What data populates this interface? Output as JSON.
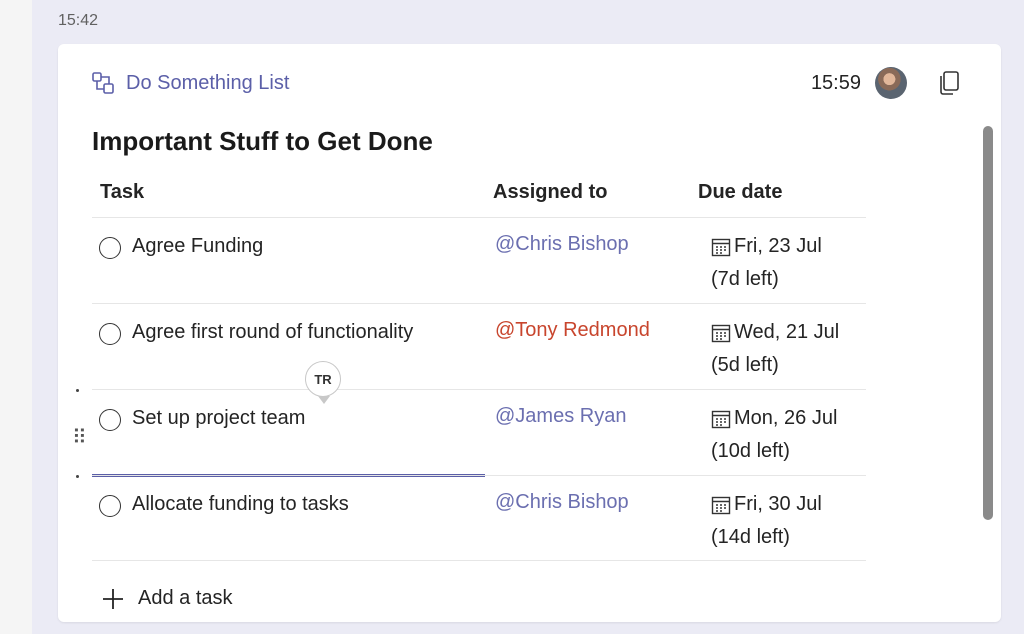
{
  "chat": {
    "message_time": "15:42"
  },
  "card": {
    "app_name": "Do Something List",
    "time": "15:59",
    "title": "Important Stuff to Get Done",
    "columns": {
      "task": "Task",
      "assigned": "Assigned to",
      "due": "Due date"
    },
    "tasks": [
      {
        "name": "Agree Funding",
        "assignee": "@Chris Bishop",
        "due": "Fri, 23 Jul",
        "left": "(7d left)"
      },
      {
        "name": "Agree first round of functionality",
        "assignee": "@Tony Redmond",
        "due": "Wed, 21 Jul",
        "left": "(5d left)"
      },
      {
        "name": "Set up project team",
        "assignee": "@James Ryan",
        "due": "Mon, 26 Jul",
        "left": "(10d left)"
      },
      {
        "name": "Allocate funding to tasks",
        "assignee": "@Chris Bishop",
        "due": "Fri, 30 Jul",
        "left": "(14d left)"
      }
    ],
    "presence_initials": "TR",
    "add_task_label": "Add a task"
  },
  "icons": {
    "app": "loop-component-icon",
    "avatar": "user-avatar",
    "copy": "copy-icon",
    "check": "circle-check-icon",
    "calendar": "calendar-icon",
    "plus": "plus-icon",
    "drag": "drag-handle-icon"
  },
  "colors": {
    "accent": "#5b5fa8",
    "mention": "#6b6fb0",
    "mention_alert": "#c8452d",
    "chat_bg": "#ebebf5"
  }
}
